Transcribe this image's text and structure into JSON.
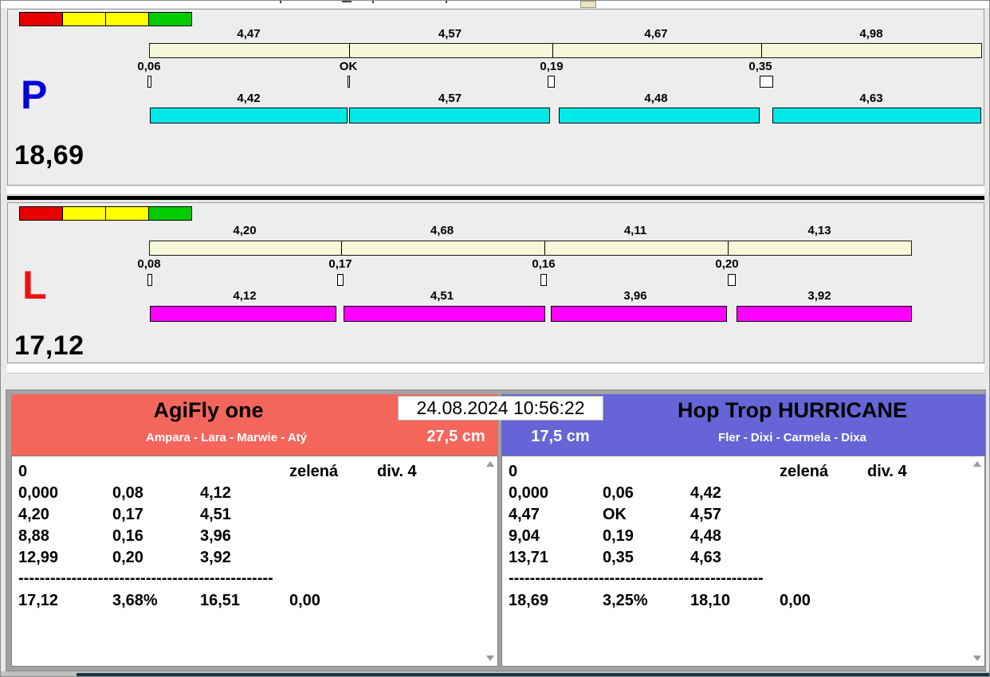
{
  "timestamp": "24.08.2024 10:56:22",
  "traffic_light_colors": [
    "#e60000",
    "#ffff00",
    "#ffff00",
    "#00cc00"
  ],
  "run_panels": [
    {
      "letter": "P",
      "letter_color": "#0000dd",
      "total": "18,69",
      "bar_color": "#00e8e8",
      "segment_labels_top": [
        "4,47",
        "4,57",
        "4,67",
        "4,98"
      ],
      "marker_labels": [
        "0,06",
        "OK",
        "0,19",
        "0,35"
      ],
      "segment_labels_bottom": [
        "4,42",
        "4,57",
        "4,48",
        "4,63"
      ]
    },
    {
      "letter": "L",
      "letter_color": "#ee1111",
      "total": "17,12",
      "bar_color": "#ff00ff",
      "segment_labels_top": [
        "4,20",
        "4,68",
        "4,11",
        "4,13"
      ],
      "marker_labels": [
        "0,08",
        "0,17",
        "0,16",
        "0,20"
      ],
      "segment_labels_bottom": [
        "4,12",
        "4,51",
        "3,96",
        "3,92"
      ]
    }
  ],
  "teams": [
    {
      "name": "AgiFly one",
      "members": "Ampara - Lara - Marwie - Atý",
      "height": "27,5 cm",
      "header_color": "#f4665c",
      "faults": "0",
      "status": "zelená",
      "division": "div. 4",
      "rows": [
        [
          "0,000",
          "0,08",
          "4,12"
        ],
        [
          "4,20",
          "0,17",
          "4,51"
        ],
        [
          "8,88",
          "0,16",
          "3,96"
        ],
        [
          "12,99",
          "0,20",
          "3,92"
        ]
      ],
      "separator": "------------------------------------------------",
      "summary": [
        "17,12",
        "3,68%",
        "16,51",
        "0,00"
      ]
    },
    {
      "name": "Hop Trop HURRICANE",
      "members": "Fler - Dixi - Carmela - Dixa",
      "height": "17,5 cm",
      "header_color": "#6565d8",
      "faults": "0",
      "status": "zelená",
      "division": "div. 4",
      "rows": [
        [
          "0,000",
          "0,06",
          "4,42"
        ],
        [
          "4,47",
          "OK",
          "4,57"
        ],
        [
          "9,04",
          "0,19",
          "4,48"
        ],
        [
          "13,71",
          "0,35",
          "4,63"
        ]
      ],
      "separator": "------------------------------------------------",
      "summary": [
        "18,69",
        "3,25%",
        "18,10",
        "0,00"
      ]
    }
  ]
}
